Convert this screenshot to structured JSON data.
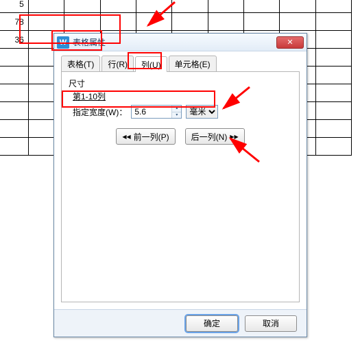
{
  "sheet": {
    "col1": [
      "5",
      "78",
      "36",
      "",
      "",
      "",
      "",
      "",
      ""
    ]
  },
  "dialog": {
    "title": "表格属性",
    "tabs": [
      "表格(T)",
      "行(R)",
      "列(U)",
      "单元格(E)"
    ],
    "active_tab_index": 2,
    "size_label": "尺寸",
    "range_label": "第1-10列",
    "width_label": "指定宽度(W)：",
    "width_value": "5.6",
    "unit_selected": "毫米",
    "prev_label": "前一列(P)",
    "next_label": "后一列(N)",
    "ok_label": "确定",
    "cancel_label": "取消"
  },
  "icons": {
    "app": "W",
    "close": "✕",
    "up": "▴",
    "down": "▾",
    "left2": "◀◀",
    "right2": "▶▶",
    "dd": "▼"
  }
}
